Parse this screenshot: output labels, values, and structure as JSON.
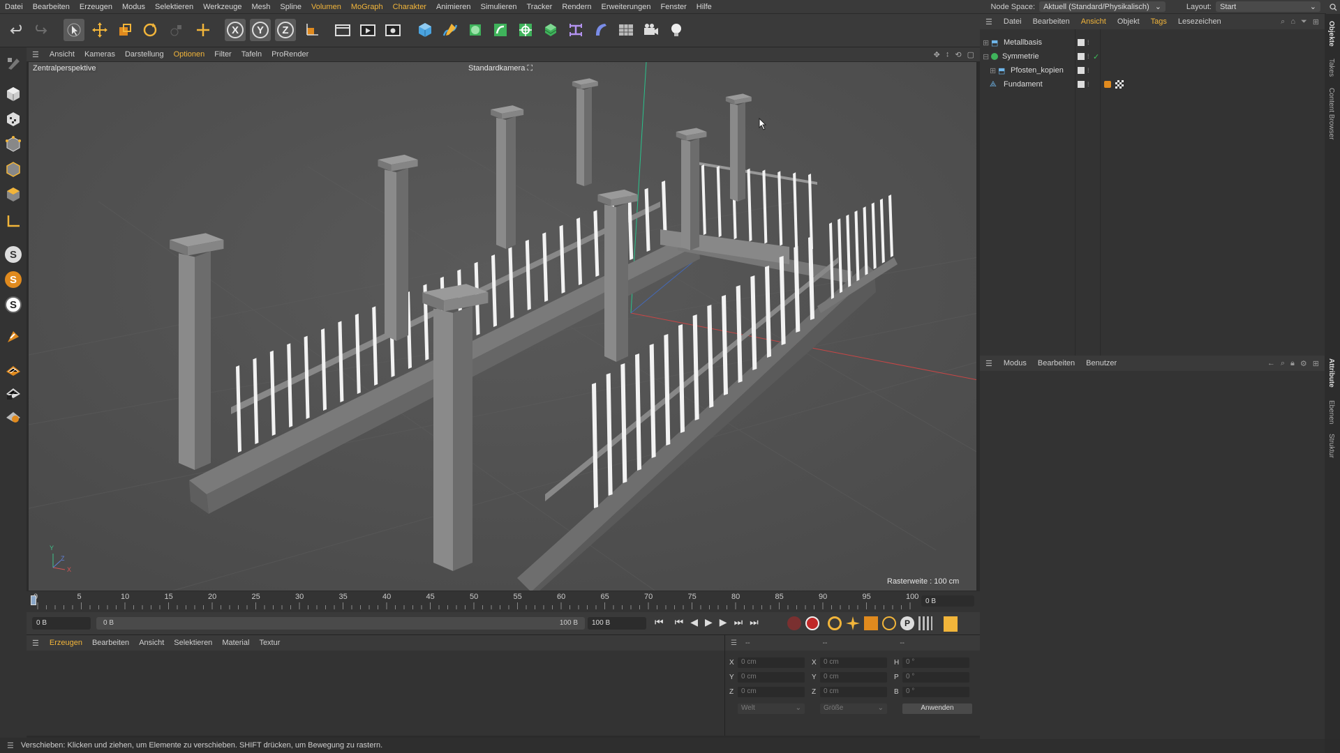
{
  "menubar": {
    "items": [
      "Datei",
      "Bearbeiten",
      "Erzeugen",
      "Modus",
      "Selektieren",
      "Werkzeuge",
      "Mesh",
      "Spline",
      "Volumen",
      "MoGraph",
      "Charakter",
      "Animieren",
      "Simulieren",
      "Tracker",
      "Rendern",
      "Erweiterungen",
      "Fenster",
      "Hilfe"
    ],
    "node_space_label": "Node Space:",
    "node_space_value": "Aktuell (Standard/Physikalisch)",
    "layout_label": "Layout:",
    "layout_value": "Start"
  },
  "viewport": {
    "menu": [
      "Ansicht",
      "Kameras",
      "Darstellung",
      "Optionen",
      "Filter",
      "Tafeln",
      "ProRender"
    ],
    "active_menu": "Optionen",
    "perspective": "Zentralperspektive",
    "camera": "Standardkamera",
    "grid_info": "Rasterweite : 100 cm",
    "axis_y": "Y",
    "axis_z": "Z",
    "axis_x": "X"
  },
  "timeline": {
    "ticks": [
      "0",
      "5",
      "10",
      "15",
      "20",
      "25",
      "30",
      "35",
      "40",
      "45",
      "50",
      "55",
      "60",
      "65",
      "70",
      "75",
      "80",
      "85",
      "90",
      "95",
      "100"
    ],
    "frame_display": "0 B"
  },
  "controls": {
    "start_field": "0 B",
    "range_start": "0 B",
    "range_end": "100 B",
    "end_field": "100 B"
  },
  "material_panel": {
    "menu": [
      "Erzeugen",
      "Bearbeiten",
      "Ansicht",
      "Selektieren",
      "Material",
      "Textur"
    ]
  },
  "coord_panel": {
    "headers": [
      "--",
      "--",
      "--"
    ],
    "rows": [
      {
        "a": "X",
        "av": "0 cm",
        "b": "X",
        "bv": "0 cm",
        "c": "H",
        "cv": "0 °"
      },
      {
        "a": "Y",
        "av": "0 cm",
        "b": "Y",
        "bv": "0 cm",
        "c": "P",
        "cv": "0 °"
      },
      {
        "a": "Z",
        "av": "0 cm",
        "b": "Z",
        "bv": "0 cm",
        "c": "B",
        "cv": "0 °"
      }
    ],
    "dropdown1": "Welt",
    "dropdown2": "Größe",
    "apply": "Anwenden"
  },
  "objects_panel": {
    "menu": [
      "Datei",
      "Bearbeiten",
      "Ansicht",
      "Objekt",
      "Tags",
      "Lesezeichen"
    ],
    "active_menu": "Ansicht",
    "objects": [
      {
        "name": "Metallbasis"
      },
      {
        "name": "Symmetrie"
      },
      {
        "name": "Pfosten_kopien"
      },
      {
        "name": "Fundament"
      }
    ]
  },
  "attributes_panel": {
    "menu": [
      "Modus",
      "Bearbeiten",
      "Benutzer"
    ]
  },
  "side_tabs": [
    "Objekte",
    "Takes",
    "Content Browser",
    "Attribute",
    "Ebenen",
    "Struktur"
  ],
  "statusbar": {
    "text": "Verschieben: Klicken und ziehen, um Elemente zu verschieben. SHIFT drücken, um Bewegung zu rastern."
  },
  "colors": {
    "accent": "#f2b53a",
    "viewport_bg": "#535353",
    "panel_bg": "#333333"
  }
}
